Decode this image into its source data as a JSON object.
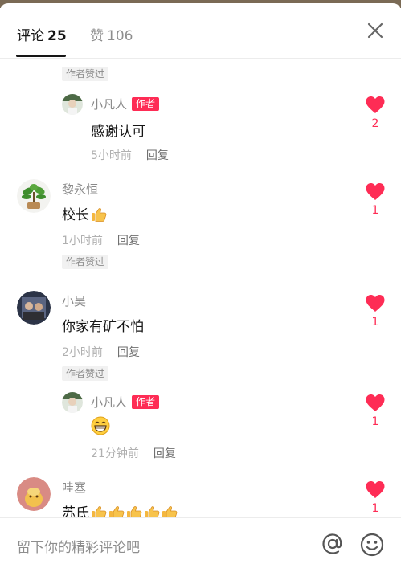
{
  "header": {
    "comments_label": "评论",
    "comments_count": "25",
    "likes_label": "赞",
    "likes_count": "106"
  },
  "comments": [
    {
      "author_liked": "作者赞过"
    },
    {
      "name": "小凡人",
      "badge": "作者",
      "text": "感谢认可",
      "time": "5小时前",
      "reply": "回复",
      "likes": "2"
    },
    {
      "name": "黎永恒",
      "text": "校长",
      "time": "1小时前",
      "reply": "回复",
      "likes": "1",
      "author_liked": "作者赞过"
    },
    {
      "name": "小吴",
      "text": "你家有矿不怕",
      "time": "2小时前",
      "reply": "回复",
      "likes": "1",
      "author_liked": "作者赞过"
    },
    {
      "name": "小凡人",
      "badge": "作者",
      "text": "",
      "time": "21分钟前",
      "reply": "回复",
      "likes": "1"
    },
    {
      "name": "哇塞",
      "text": "苏氏",
      "likes": "1"
    }
  ],
  "footer": {
    "placeholder": "留下你的精彩评论吧"
  },
  "colors": {
    "accent": "#fe2c55",
    "muted": "#8a8a8a"
  },
  "icons": [
    "close-icon",
    "heart-icon",
    "thumbs-up-emoji",
    "grin-emoji",
    "at-icon",
    "emoji-icon"
  ]
}
